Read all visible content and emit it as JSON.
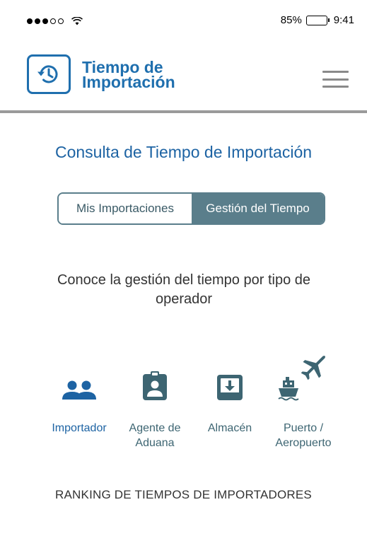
{
  "status": {
    "battery_percent": "85%",
    "battery_level": 0.85,
    "time": "9:41"
  },
  "header": {
    "app_title_line1": "Tiempo de",
    "app_title_line2": "Importación",
    "logo_icon": "history-icon",
    "menu_icon": "hamburger-menu-icon",
    "brand_color": "#1f6fae"
  },
  "main": {
    "title": "Consulta de Tiempo de Importación",
    "tabs": [
      {
        "label": "Mis Importaciones",
        "selected": false
      },
      {
        "label": "Gestión del Tiempo",
        "selected": true
      }
    ],
    "subtitle": "Conoce la gestión del tiempo por tipo de operador",
    "operators": [
      {
        "label_line1": "Importador",
        "label_line2": "",
        "icon": "people-icon",
        "active": true
      },
      {
        "label_line1": "Agente de",
        "label_line2": "Aduana",
        "icon": "id-badge-icon",
        "active": false
      },
      {
        "label_line1": "Almacén",
        "label_line2": "",
        "icon": "warehouse-inbox-icon",
        "active": false
      },
      {
        "label_line1": "Puerto /",
        "label_line2": "Aeropuerto",
        "icon": "ship-plane-icon",
        "active": false
      }
    ],
    "ranking_heading": "RANKING DE TIEMPOS DE IMPORTADORES"
  },
  "colors": {
    "accent": "#1d63a3",
    "segment": "#5a7e8b",
    "icon_gray": "#3d6572"
  }
}
